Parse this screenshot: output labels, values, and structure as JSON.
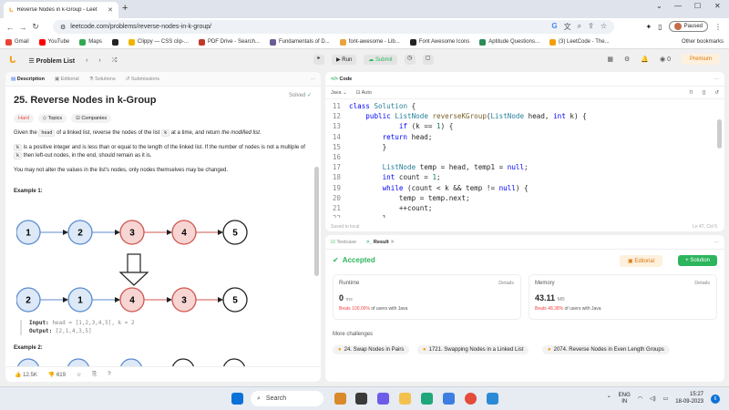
{
  "browser": {
    "tab_title": "Reverse Nodes in k-Group - Leet",
    "url": "leetcode.com/problems/reverse-nodes-in-k-group/",
    "profile_status": "Paused",
    "bookmarks": [
      {
        "label": "Gmail",
        "color": "#ea4335"
      },
      {
        "label": "YouTube",
        "color": "#ff0000"
      },
      {
        "label": "Maps",
        "color": "#34a853"
      },
      {
        "label": "",
        "color": "#222222"
      },
      {
        "label": "Clippy — CSS clip-...",
        "color": "#f0b400"
      },
      {
        "label": "PDF Drive - Search...",
        "color": "#c0392b"
      },
      {
        "label": "Fundamentals of D...",
        "color": "#6b5b95"
      },
      {
        "label": "font-awesome - Lib...",
        "color": "#e8a33d"
      },
      {
        "label": "Font Awesome Icons",
        "color": "#222222"
      },
      {
        "label": "Aptitude Questions...",
        "color": "#2e8b57"
      },
      {
        "label": "(3) LeetCode - The...",
        "color": "#f59e0b"
      }
    ],
    "other_bookmarks": "Other bookmarks"
  },
  "lc": {
    "problem_list": "Problem List",
    "run": "Run",
    "submit": "Submit",
    "streak": "0",
    "premium": "Premium"
  },
  "description": {
    "tabs": [
      "Description",
      "Editorial",
      "Solutions",
      "Submissions"
    ],
    "title": "25. Reverse Nodes in k-Group",
    "solved": "Solved",
    "difficulty": "Hard",
    "topics": "Topics",
    "companies": "Companies",
    "p1_a": "Given the ",
    "p1_code": "head",
    "p1_b": " of a linked list, reverse the nodes of the list ",
    "p1_k": "k",
    "p1_c": " at a time, and return ",
    "p1_em": "the modified list",
    "p1_d": ".",
    "p2_a": "k",
    "p2_b": " is a positive integer and is less than or equal to the length of the linked list. If the number of nodes is not a multiple of ",
    "p2_c": "k",
    "p2_d": " then left-out nodes, in the end, should remain as it is.",
    "p3": "You may not alter the values in the list's nodes, only nodes themselves may be changed.",
    "example1": "Example 1:",
    "input_label": "Input:",
    "input_value": "head = [1,2,3,4,5], k = 2",
    "output_label": "Output:",
    "output_value": "[2,1,4,3,5]",
    "example2": "Example 2:",
    "likes": "12.5K",
    "dislikes": "619",
    "list_before": [
      "1",
      "2",
      "3",
      "4",
      "5"
    ],
    "list_after": [
      "2",
      "1",
      "4",
      "3",
      "5"
    ]
  },
  "code": {
    "tab": "Code",
    "language": "Java",
    "mode": "Auto",
    "saved": "Saved to local",
    "position": "Ln 47, Col 5",
    "lines": [
      "11",
      "12",
      "13",
      "14",
      "15",
      "16",
      "17",
      "18",
      "19",
      "20",
      "21",
      "22"
    ]
  },
  "result": {
    "tabs": [
      "Testcase",
      "Result"
    ],
    "status": "Accepted",
    "editorial": "Editorial",
    "solution": "Solution",
    "runtime_label": "Runtime",
    "memory_label": "Memory",
    "details": "Details",
    "runtime_value": "0",
    "runtime_unit": "ms",
    "runtime_beats": "Beats 100.00%",
    "memory_value": "43.11",
    "memory_unit": "MB",
    "memory_beats": "Beats 48.38%",
    "beats_suffix": "of users with Java",
    "more_challenges": "More challenges",
    "challenges": [
      "24. Swap Nodes in Pairs",
      "1721. Swapping Nodes in a Linked List",
      "2074. Reverse Nodes in Even Length Groups"
    ]
  },
  "taskbar": {
    "search": "Search",
    "lang": "ENG",
    "region": "IN",
    "time": "15:27",
    "date": "18-09-2023",
    "badge": "6"
  }
}
